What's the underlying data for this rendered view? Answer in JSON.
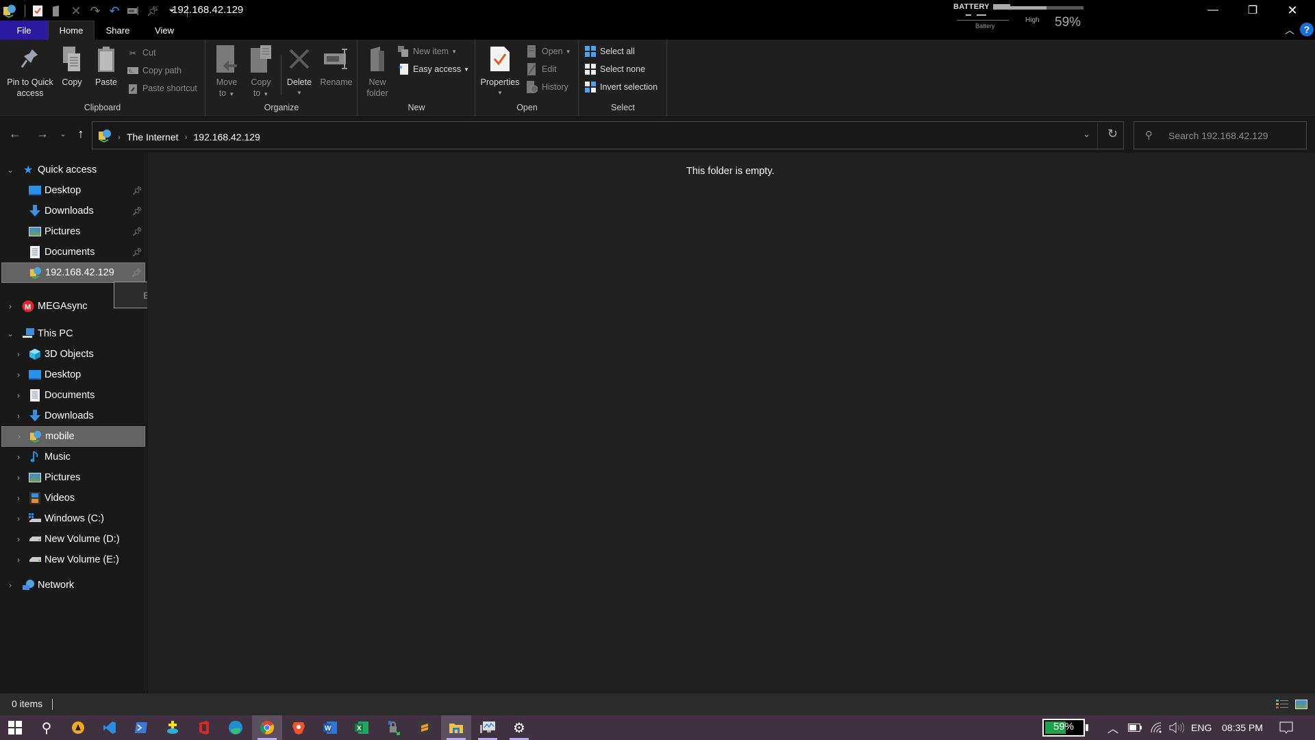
{
  "window": {
    "title": "192.168.42.129",
    "qat_icons": [
      "network-location-icon",
      "properties-icon",
      "new-folder-icon",
      "delete-icon",
      "redo-icon",
      "undo-icon",
      "rename-icon",
      "pin-icon",
      "customize-dropdown-icon"
    ],
    "controls": {
      "minimize": "—",
      "restore": "❐",
      "close": "✕"
    }
  },
  "battery_widget": {
    "title": "BATTERY",
    "subtitle": "Battery",
    "level_label": "High",
    "percent_text": "59%",
    "level": 0.59
  },
  "tabs": [
    {
      "label": "File",
      "active": false
    },
    {
      "label": "Home",
      "active": true
    },
    {
      "label": "Share",
      "active": false
    },
    {
      "label": "View",
      "active": false
    }
  ],
  "ribbon": {
    "clipboard": {
      "label": "Clipboard",
      "pin": "Pin to Quick access",
      "pin_line1": "Pin to Quick",
      "pin_line2": "access",
      "copy": "Copy",
      "paste": "Paste",
      "cut": "Cut",
      "copy_path": "Copy path",
      "paste_shortcut": "Paste shortcut"
    },
    "organize": {
      "label": "Organize",
      "move_to_line1": "Move",
      "move_to_line2": "to",
      "copy_to_line1": "Copy",
      "copy_to_line2": "to",
      "delete": "Delete",
      "rename": "Rename"
    },
    "new": {
      "label": "New",
      "new_folder_line1": "New",
      "new_folder_line2": "folder",
      "new_item": "New item",
      "easy_access": "Easy access"
    },
    "open": {
      "label": "Open",
      "properties": "Properties",
      "open": "Open",
      "edit": "Edit",
      "history": "History"
    },
    "select": {
      "label": "Select",
      "select_all": "Select all",
      "select_none": "Select none",
      "invert_selection": "Invert selection"
    }
  },
  "address": {
    "breadcrumbs": [
      "The Internet",
      "192.168.42.129"
    ],
    "search_placeholder": "Search 192.168.42.129"
  },
  "nav_pane": {
    "quick_access": {
      "label": "Quick access",
      "items": [
        {
          "label": "Desktop",
          "icon": "desktop-icon",
          "pinned": true
        },
        {
          "label": "Downloads",
          "icon": "downloads-icon",
          "pinned": true
        },
        {
          "label": "Pictures",
          "icon": "pictures-icon",
          "pinned": true
        },
        {
          "label": "Documents",
          "icon": "documents-icon",
          "pinned": true
        },
        {
          "label": "192.168.42.129",
          "icon": "network-location-icon",
          "pinned": true,
          "selected": true
        }
      ]
    },
    "megasync": {
      "label": "MEGAsync"
    },
    "this_pc": {
      "label": "This PC",
      "items": [
        {
          "label": "3D Objects",
          "icon": "3d-objects-icon"
        },
        {
          "label": "Desktop",
          "icon": "desktop-icon"
        },
        {
          "label": "Documents",
          "icon": "documents-icon"
        },
        {
          "label": "Downloads",
          "icon": "downloads-icon"
        },
        {
          "label": "mobile",
          "icon": "network-location-icon",
          "selected": true
        },
        {
          "label": "Music",
          "icon": "music-icon"
        },
        {
          "label": "Pictures",
          "icon": "pictures-icon"
        },
        {
          "label": "Videos",
          "icon": "videos-icon"
        },
        {
          "label": "Windows (C:)",
          "icon": "windows-drive-icon"
        },
        {
          "label": "New Volume (D:)",
          "icon": "drive-icon"
        },
        {
          "label": "New Volume (E:)",
          "icon": "drive-icon"
        }
      ]
    },
    "network": {
      "label": "Network"
    }
  },
  "popup": {
    "label": "Expand"
  },
  "content": {
    "empty_message": "This folder is empty."
  },
  "status": {
    "item_count": "0 items"
  },
  "taskbar": {
    "apps": [
      "start-icon",
      "search-icon",
      "app-a-icon",
      "vscode-icon",
      "powershell-icon",
      "app-plus-icon",
      "office-icon",
      "edge-icon",
      "chrome-icon",
      "brave-icon",
      "word-icon",
      "excel-icon",
      "vpn-lock-icon",
      "sublime-icon",
      "file-explorer-icon",
      "performance-monitor-icon",
      "settings-icon"
    ],
    "battery_percent": "59%",
    "battery_level": 0.59,
    "language": "ENG",
    "time": "08:35 PM"
  },
  "colors": {
    "file_tab": "#2b1aa1",
    "accent_blue": "#1a6fd6",
    "battery_green": "#1fa24a",
    "taskbar": "#3f3140",
    "taskbar_indicator": "#b7a8f0"
  }
}
